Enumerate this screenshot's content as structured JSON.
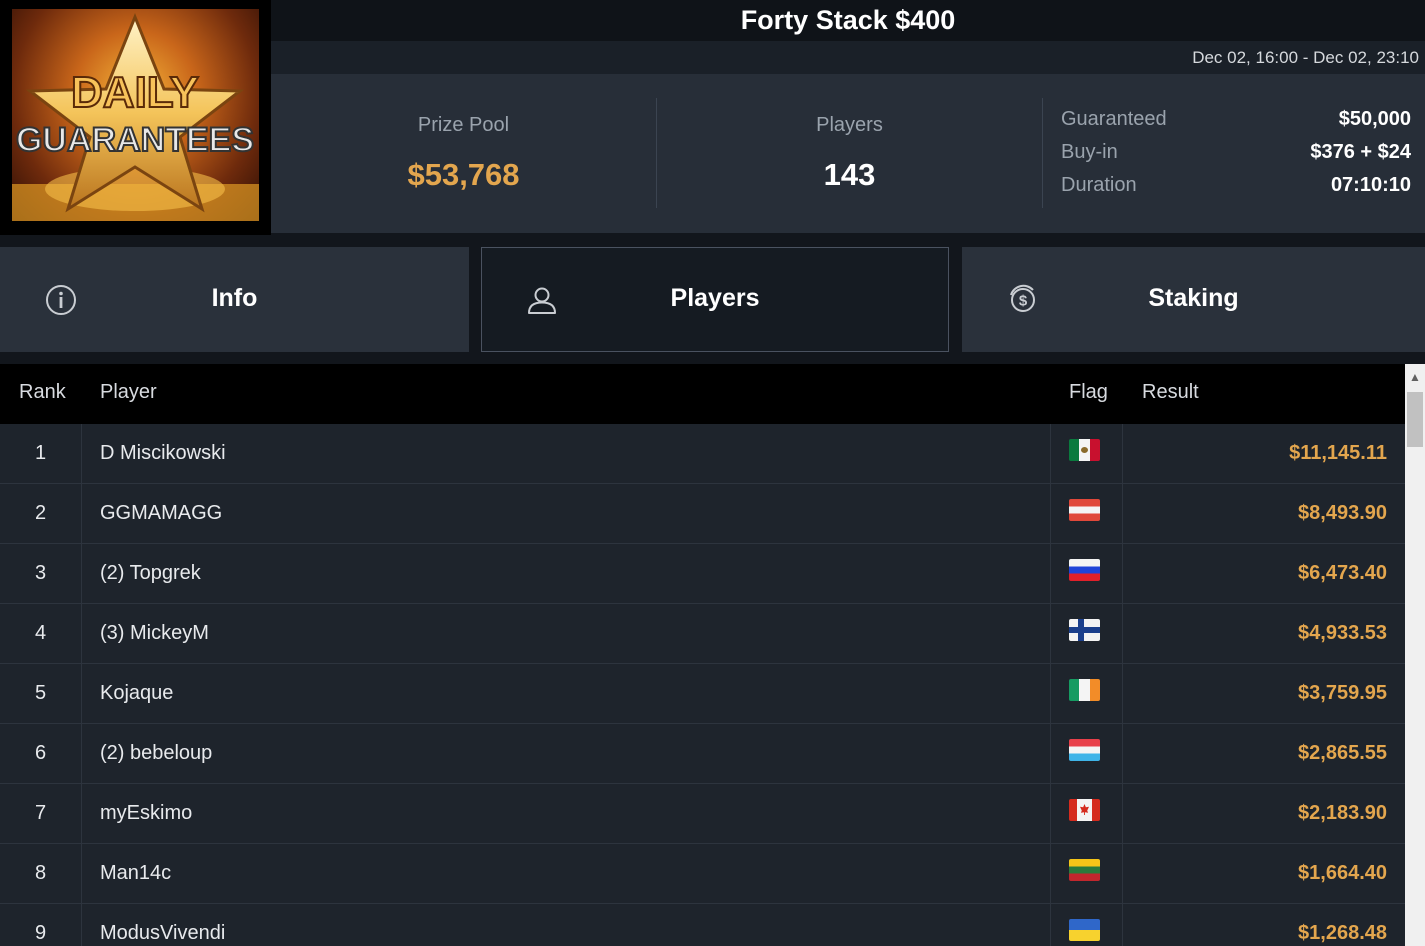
{
  "logo": {
    "text_line1": "DAILY",
    "text_line2": "GUARANTEES"
  },
  "tournament": {
    "title": "Forty Stack $400",
    "date_range": "Dec 02, 16:00 - Dec 02, 23:10"
  },
  "stats": {
    "prize_pool_label": "Prize Pool",
    "prize_pool_value": "$53,768",
    "players_label": "Players",
    "players_value": "143",
    "details": [
      {
        "key": "Guaranteed",
        "value": "$50,000"
      },
      {
        "key": "Buy-in",
        "value": "$376 + $24"
      },
      {
        "key": "Duration",
        "value": "07:10:10"
      }
    ]
  },
  "tabs": [
    {
      "label": "Info",
      "icon": "info-icon",
      "active": false
    },
    {
      "label": "Players",
      "icon": "user-icon",
      "active": true
    },
    {
      "label": "Staking",
      "icon": "dollar-coin-icon",
      "active": false
    }
  ],
  "table": {
    "headers": {
      "rank": "Rank",
      "player": "Player",
      "flag": "Flag",
      "result": "Result"
    },
    "rows": [
      {
        "rank": "1",
        "player": "D Miscikowski",
        "flag": "mexico",
        "result": "$11,145.11"
      },
      {
        "rank": "2",
        "player": "GGMAMAGG",
        "flag": "austria",
        "result": "$8,493.90"
      },
      {
        "rank": "3",
        "player": "(2) Topgrek",
        "flag": "russia",
        "result": "$6,473.40"
      },
      {
        "rank": "4",
        "player": "(3) MickeyM",
        "flag": "finland",
        "result": "$4,933.53"
      },
      {
        "rank": "5",
        "player": "Kojaque",
        "flag": "ireland",
        "result": "$3,759.95"
      },
      {
        "rank": "6",
        "player": "(2) bebeloup",
        "flag": "luxembourg",
        "result": "$2,865.55"
      },
      {
        "rank": "7",
        "player": "myEskimo",
        "flag": "canada",
        "result": "$2,183.90"
      },
      {
        "rank": "8",
        "player": "Man14c",
        "flag": "lithuania",
        "result": "$1,664.40"
      },
      {
        "rank": "9",
        "player": "ModusVivendi",
        "flag": "ukraine",
        "result": "$1,268.48"
      }
    ]
  },
  "colors": {
    "accent_gold": "#e3a64e",
    "background": "#12161c",
    "panel": "#272e38"
  }
}
